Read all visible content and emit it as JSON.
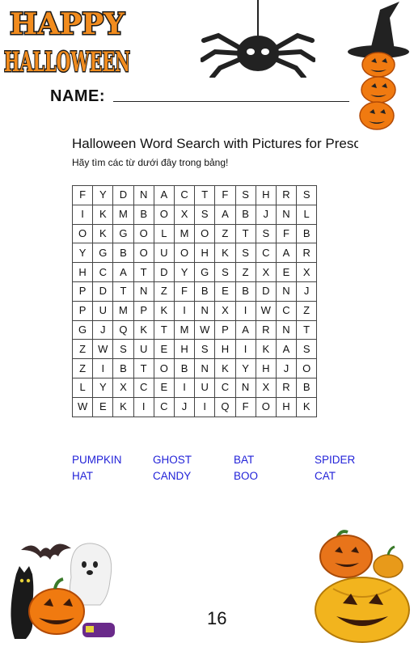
{
  "header": {
    "logo_line1": "HAPPY",
    "logo_line2": "HALLOWEEN",
    "name_label": "NAME:"
  },
  "worksheet": {
    "title": "Halloween Word Search with Pictures for Preschool",
    "subtitle": "Hãy tìm các từ dưới đây trong bảng!"
  },
  "grid": [
    [
      "F",
      "Y",
      "D",
      "N",
      "A",
      "C",
      "T",
      "F",
      "S",
      "H",
      "R",
      "S"
    ],
    [
      "I",
      "K",
      "M",
      "B",
      "O",
      "X",
      "S",
      "A",
      "B",
      "J",
      "N",
      "L"
    ],
    [
      "O",
      "K",
      "G",
      "O",
      "L",
      "M",
      "O",
      "Z",
      "T",
      "S",
      "F",
      "B"
    ],
    [
      "Y",
      "G",
      "B",
      "O",
      "U",
      "O",
      "H",
      "K",
      "S",
      "C",
      "A",
      "R"
    ],
    [
      "H",
      "C",
      "A",
      "T",
      "D",
      "Y",
      "G",
      "S",
      "Z",
      "X",
      "E",
      "X"
    ],
    [
      "P",
      "D",
      "T",
      "N",
      "Z",
      "F",
      "B",
      "E",
      "B",
      "D",
      "N",
      "J"
    ],
    [
      "P",
      "U",
      "M",
      "P",
      "K",
      "I",
      "N",
      "X",
      "I",
      "W",
      "C",
      "Z"
    ],
    [
      "G",
      "J",
      "Q",
      "K",
      "T",
      "M",
      "W",
      "P",
      "A",
      "R",
      "N",
      "T"
    ],
    [
      "Z",
      "W",
      "S",
      "U",
      "E",
      "H",
      "S",
      "H",
      "I",
      "K",
      "A",
      "S"
    ],
    [
      "Z",
      "I",
      "B",
      "T",
      "O",
      "B",
      "N",
      "K",
      "Y",
      "H",
      "J",
      "O"
    ],
    [
      "L",
      "Y",
      "X",
      "C",
      "E",
      "I",
      "U",
      "C",
      "N",
      "X",
      "R",
      "B"
    ],
    [
      "W",
      "E",
      "K",
      "I",
      "C",
      "J",
      "I",
      "Q",
      "F",
      "O",
      "H",
      "K"
    ]
  ],
  "word_list": [
    "PUMPKIN",
    "GHOST",
    "BAT",
    "SPIDER",
    "HAT",
    "CANDY",
    "BOO",
    "CAT"
  ],
  "footer": {
    "page_number": "16"
  },
  "colors": {
    "word_blue": "#2222d8",
    "logo_orange": "#f28c1e",
    "pumpkin_orange": "#f07a10"
  }
}
